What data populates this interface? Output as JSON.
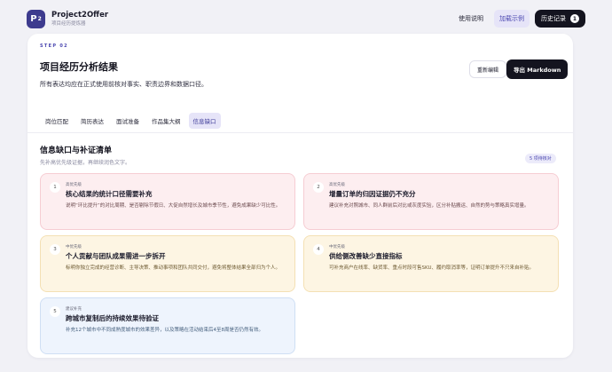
{
  "header": {
    "logo_text": "P",
    "logo_sup": "2",
    "brand_name": "Project2Offer",
    "brand_sub": "项目经历提炼器",
    "nav": {
      "guide": "使用说明",
      "load_example": "加载示例",
      "history": "历史记录",
      "history_count": "1"
    }
  },
  "page": {
    "step": "STEP 02",
    "title": "项目经历分析结果",
    "description": "所有表达均应在正式使用前核对事实、职责边界和数据口径。",
    "buttons": {
      "reedit": "重新编辑",
      "export": "导出 Markdown"
    },
    "tabs": [
      {
        "label": "岗位匹配",
        "active": false
      },
      {
        "label": "简历表达",
        "active": false
      },
      {
        "label": "面试准备",
        "active": false
      },
      {
        "label": "作品集大纲",
        "active": false
      },
      {
        "label": "信息缺口",
        "active": true
      }
    ]
  },
  "section": {
    "title": "信息缺口与补证清单",
    "subtitle": "先补高优先级证据，再继续润色文字。",
    "pending": "5 项待核对"
  },
  "gaps": [
    {
      "num": "1",
      "priority": "高优先级",
      "title": "核心结果的统计口径需要补充",
      "desc": "说明“环比提升”的对比周期、是否剔除节假日、大促自然增长及城市季节性，避免成果缺少可比性。",
      "level": "high"
    },
    {
      "num": "2",
      "priority": "高优先级",
      "title": "增量订单的归因证据仍不充分",
      "desc": "建议补充对照城市、同人群前后对比或灰度实验，区分补贴搬运、自然的势与策略真实增量。",
      "level": "high"
    },
    {
      "num": "3",
      "priority": "中优先级",
      "title": "个人贡献与团队成果需进一步拆开",
      "desc": "标明你独立完成的经营诊断、主导决策、推动事项和团队共同交付，避免将整体结果全部归为个人。",
      "level": "mid"
    },
    {
      "num": "4",
      "priority": "中优先级",
      "title": "供给侧改善缺少直接指标",
      "desc": "可补充商户在线率、缺货率、重点时段可售SKU、履约取消率等，证明订单提升不只来自补贴。",
      "level": "mid"
    },
    {
      "num": "5",
      "priority": "建议补充",
      "title": "跨城市复制后的持续效果待验证",
      "desc": "补充12个城市中不同成熟度城市的效果差异，以及策略在活动结束后4至8周是否仍然有效。",
      "level": "low"
    }
  ],
  "colors": {
    "accent": "#4b47b0",
    "dark": "#14141f",
    "high_bg": "#fdeef0",
    "mid_bg": "#fdf5e3",
    "low_bg": "#eef4fd"
  }
}
